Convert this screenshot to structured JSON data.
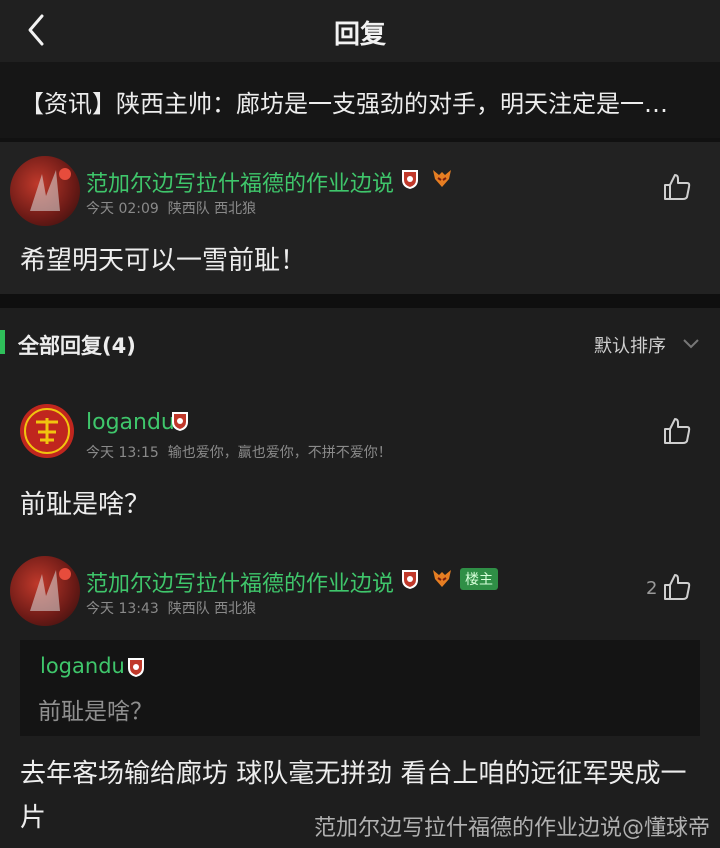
{
  "header": {
    "title": "回复"
  },
  "article": {
    "title": "【资讯】陕西主帅：廊坊是一支强劲的对手，明天注定是一场…"
  },
  "post": {
    "username": "范加尔边写拉什福德的作业边说",
    "time": "今天 02:09",
    "team": "陕西队",
    "fan_group": "西北狼",
    "content": "希望明天可以一雪前耻！"
  },
  "section": {
    "title": "全部回复(4)",
    "sort_label": "默认排序"
  },
  "replies": [
    {
      "username": "logandu",
      "time": "今天 13:15",
      "signature": "输也爱你，赢也爱你，不拼不爱你！",
      "content": "前耻是啥？"
    },
    {
      "username": "范加尔边写拉什福德的作业边说",
      "host_badge": "楼主",
      "time": "今天 13:43",
      "team": "陕西队",
      "fan_group": "西北狼",
      "like_count": "2",
      "quote_user": "logandu",
      "quote_text": "前耻是啥？",
      "content": "去年客场输给廊坊 球队毫无拼劲 看台上咱的远征军哭成一片"
    }
  ],
  "watermark": "范加尔边写拉什福德的作业边说@懂球帝",
  "colors": {
    "accent": "#3fc66b",
    "background": "#1e1e1e",
    "host_badge": "#2f8f46"
  },
  "icons": [
    "back-icon",
    "like-icon",
    "team-shield-icon",
    "wolf-badge-icon",
    "chevron-down-icon"
  ]
}
